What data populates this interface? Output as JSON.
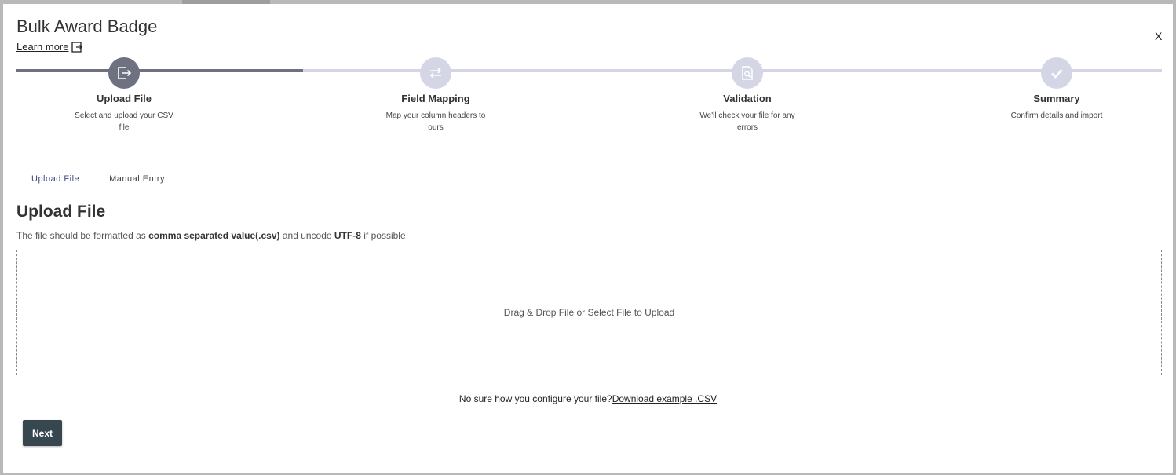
{
  "modal": {
    "title": "Bulk Award Badge",
    "learn_more": "Learn more",
    "close": "X"
  },
  "stepper": {
    "progress_percent": 25,
    "steps": [
      {
        "label": "Upload File",
        "desc": "Select and upload your CSV file",
        "icon": "upload-file-icon",
        "state": "active"
      },
      {
        "label": "Field Mapping",
        "desc": "Map your column headers to ours",
        "icon": "swap-arrows-icon",
        "state": "inactive"
      },
      {
        "label": "Validation",
        "desc": "We'll check your file for any errors",
        "icon": "file-search-icon",
        "state": "inactive"
      },
      {
        "label": "Summary",
        "desc": "Confirm details and import",
        "icon": "checkmark-icon",
        "state": "inactive"
      }
    ]
  },
  "tabs": [
    {
      "label": "Upload File",
      "active": true
    },
    {
      "label": "Manual Entry",
      "active": false
    }
  ],
  "upload": {
    "title": "Upload File",
    "note_prefix": "The file should be formatted as ",
    "note_format": "comma separated value(.csv)",
    "note_mid": " and uncode ",
    "note_encoding": "UTF-8",
    "note_suffix": " if possible",
    "dropzone_text": "Drag & Drop File or Select File to Upload",
    "help_text": "No sure how you configure your file?",
    "help_link": "Download example .CSV"
  },
  "actions": {
    "next": "Next"
  },
  "colors": {
    "step_active": "#6e7280",
    "step_inactive": "#d4d6e6",
    "tab_active": "#3a4a82",
    "button": "#37474f"
  }
}
